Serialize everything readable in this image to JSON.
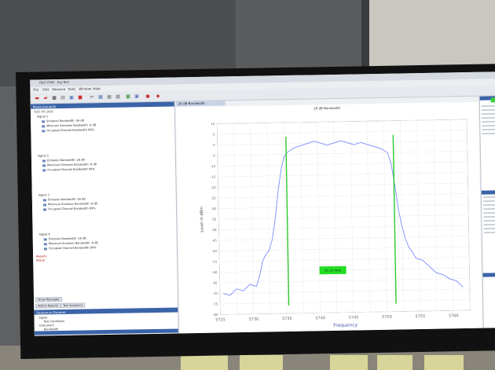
{
  "window": {
    "title": "R&S FSW - Sig Test",
    "menus": [
      "File",
      "Edit",
      "Measure",
      "Tools",
      "Window",
      "Help"
    ]
  },
  "left_panel": {
    "header": "Measurements",
    "date": "7/25 7/5 2019",
    "groups": [
      {
        "label": "Signal 1",
        "items": [
          "Emission Bandwidth -26 dB",
          "Minimum Emission Bandwidth -6 dB",
          "Occupied Channel Bandwidth 99%"
        ]
      },
      {
        "label": "Signal 2",
        "items": [
          "Emission Bandwidth -26 dB",
          "Minimum Emission Bandwidth -6 dB",
          "Occupied Channel Bandwidth 99%"
        ]
      },
      {
        "label": "Signal 3",
        "items": [
          "Emission Bandwidth -26 dB",
          "Minimum Emission Bandwidth -6 dB",
          "Occupied Channel Bandwidth 99%"
        ]
      },
      {
        "label": "Signal 4",
        "items": [
          "Emission Bandwidth -26 dB",
          "Minimum Emission Bandwidth -6 dB",
          "Occupied Channel Bandwidth 99%"
        ]
      }
    ],
    "footer_items": [
      "Reports",
      "Result"
    ],
    "buttons": [
      "Show Messages",
      "Add to Reports",
      "Test Sequence"
    ],
    "sub_header": "Sequence Explorer",
    "sub_items": [
      "Signal",
      "Test Conditions",
      "Instrument",
      "Bandwidth"
    ]
  },
  "doc_tab": "26 dB Bandwidth",
  "chart_caption": "26 dB Bandwidth",
  "right_panel": {
    "header": "Properties"
  },
  "chart_data": {
    "type": "line",
    "xlabel": "Frequency",
    "ylabel": "Level in dBm",
    "xlim": [
      5725,
      5800
    ],
    "ylim": [
      -80,
      10
    ],
    "x_ticks": [
      5725,
      5730,
      5735,
      5740,
      5745,
      5750,
      5755,
      5760,
      5765,
      5770,
      5775,
      5780,
      5785,
      5790,
      5795,
      5800
    ],
    "x_tick_labels": [
      "5725",
      "",
      "5730",
      "",
      "5735",
      "",
      "5740",
      "",
      "5745",
      "",
      "5750",
      "",
      "5755",
      "",
      "5760",
      ""
    ],
    "y_ticks": [
      10,
      5,
      0,
      -5,
      -10,
      -15,
      -20,
      -25,
      -30,
      -35,
      -40,
      -45,
      -50,
      -55,
      -60,
      -65,
      -70,
      -75,
      -80
    ],
    "grid": true,
    "series": [
      {
        "color": "#7a8cff",
        "x": [
          5726,
          5728,
          5730,
          5732,
          5734,
          5736,
          5737,
          5738,
          5739,
          5740,
          5741,
          5742,
          5743,
          5744,
          5745,
          5746,
          5747,
          5748,
          5750,
          5752,
          5754,
          5756,
          5758,
          5760,
          5762,
          5764,
          5766,
          5768,
          5770,
          5772,
          5774,
          5776,
          5777,
          5778,
          5779,
          5780,
          5781,
          5782,
          5783,
          5784,
          5786,
          5788,
          5790,
          5792,
          5794,
          5796,
          5798
        ],
        "y": [
          -70,
          -71,
          -68,
          -69,
          -66,
          -67,
          -62,
          -55,
          -52,
          -50,
          -45,
          -35,
          -22,
          -12,
          -6,
          -4,
          -3,
          -2,
          -1,
          0,
          1,
          0,
          -1,
          0,
          1,
          0,
          -1,
          0,
          -1,
          -2,
          -3,
          -5,
          -10,
          -20,
          -32,
          -40,
          -46,
          -50,
          -52,
          -55,
          -56,
          -59,
          -62,
          -63,
          -65,
          -66,
          -69
        ]
      }
    ],
    "markers": [
      {
        "x": 5745.6,
        "color": "#2ec82e"
      },
      {
        "x": 5777.8,
        "color": "#2ec82e"
      }
    ],
    "annotation": {
      "text": "31.19 MHz",
      "x": 5759,
      "y": -60,
      "color": "#22dd22"
    }
  }
}
